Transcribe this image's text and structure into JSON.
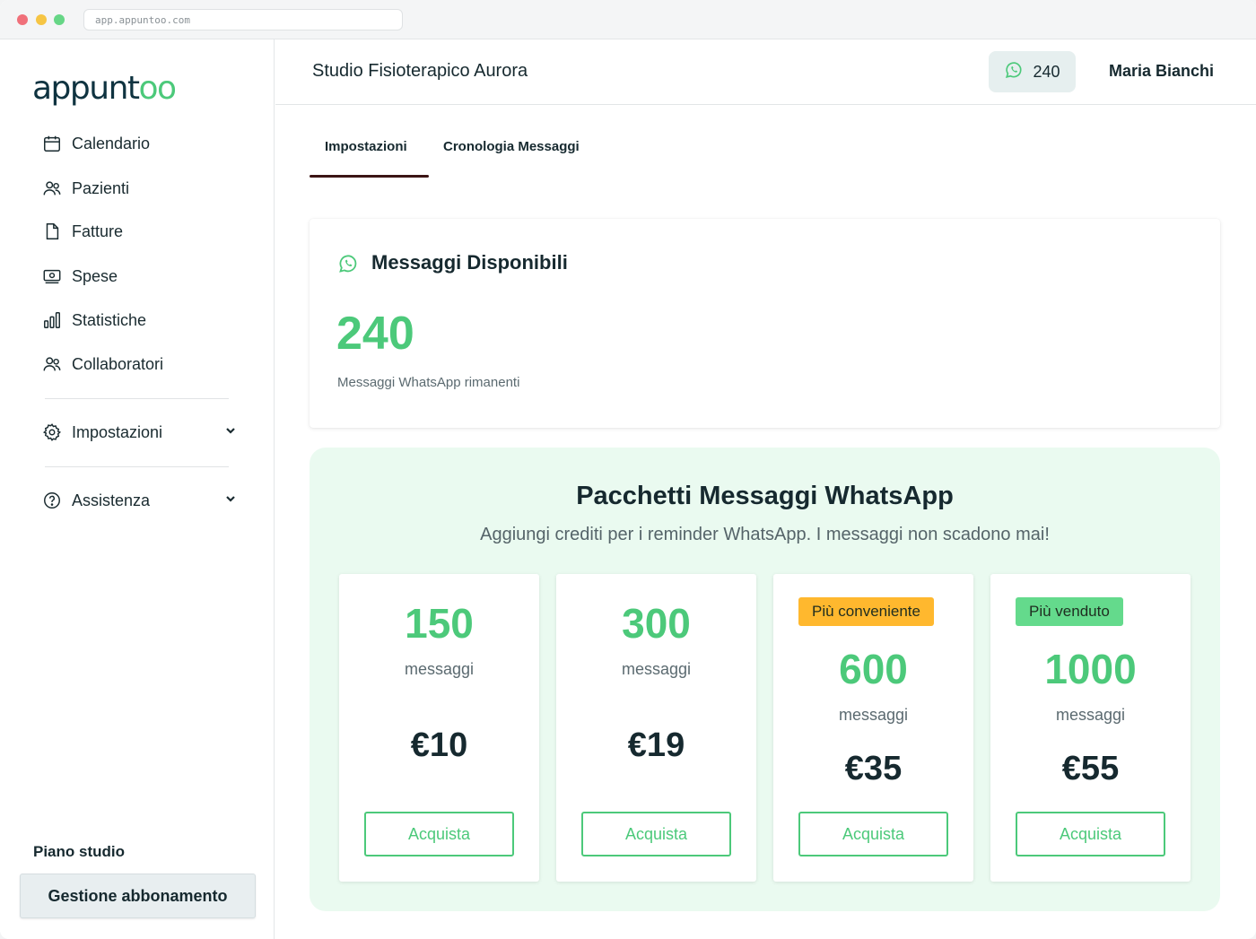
{
  "browser": {
    "url": "app.appuntoo.com"
  },
  "brand": {
    "logo_main": "appunt",
    "logo_accent": "oo"
  },
  "sidebar": {
    "items": [
      {
        "label": "Calendario",
        "icon": "calendar-icon"
      },
      {
        "label": "Pazienti",
        "icon": "users-icon"
      },
      {
        "label": "Fatture",
        "icon": "document-icon"
      },
      {
        "label": "Spese",
        "icon": "cash-icon"
      },
      {
        "label": "Statistiche",
        "icon": "bar-chart-icon"
      },
      {
        "label": "Collaboratori",
        "icon": "users-icon"
      }
    ],
    "settings": {
      "label": "Impostazioni",
      "icon": "gear-icon"
    },
    "help": {
      "label": "Assistenza",
      "icon": "question-icon"
    },
    "plan_title": "Piano studio",
    "plan_button": "Gestione abbonamento"
  },
  "header": {
    "studio_name": "Studio Fisioterapico Aurora",
    "message_count": "240",
    "user_name": "Maria Bianchi"
  },
  "tabs": [
    {
      "label": "Impostazioni",
      "active": true
    },
    {
      "label": "Cronologia Messaggi",
      "active": false
    }
  ],
  "available": {
    "title": "Messaggi Disponibili",
    "count": "240",
    "subtitle": "Messaggi WhatsApp rimanenti"
  },
  "packages": {
    "title": "Pacchetti Messaggi WhatsApp",
    "subtitle": "Aggiungi crediti per i reminder WhatsApp. I messaggi non scadono mai!",
    "items": [
      {
        "badge": "",
        "quantity": "150",
        "unit": "messaggi",
        "price": "€10",
        "button": "Acquista"
      },
      {
        "badge": "",
        "quantity": "300",
        "unit": "messaggi",
        "price": "€19",
        "button": "Acquista"
      },
      {
        "badge": "Più conveniente",
        "quantity": "600",
        "unit": "messaggi",
        "price": "€35",
        "button": "Acquista"
      },
      {
        "badge": "Più venduto",
        "quantity": "1000",
        "unit": "messaggi",
        "price": "€55",
        "button": "Acquista"
      }
    ]
  },
  "colors": {
    "accent": "#4cc97a",
    "badge_orange": "#ffb82e",
    "badge_green": "#64da8c",
    "tab_underline": "#3b1414"
  }
}
